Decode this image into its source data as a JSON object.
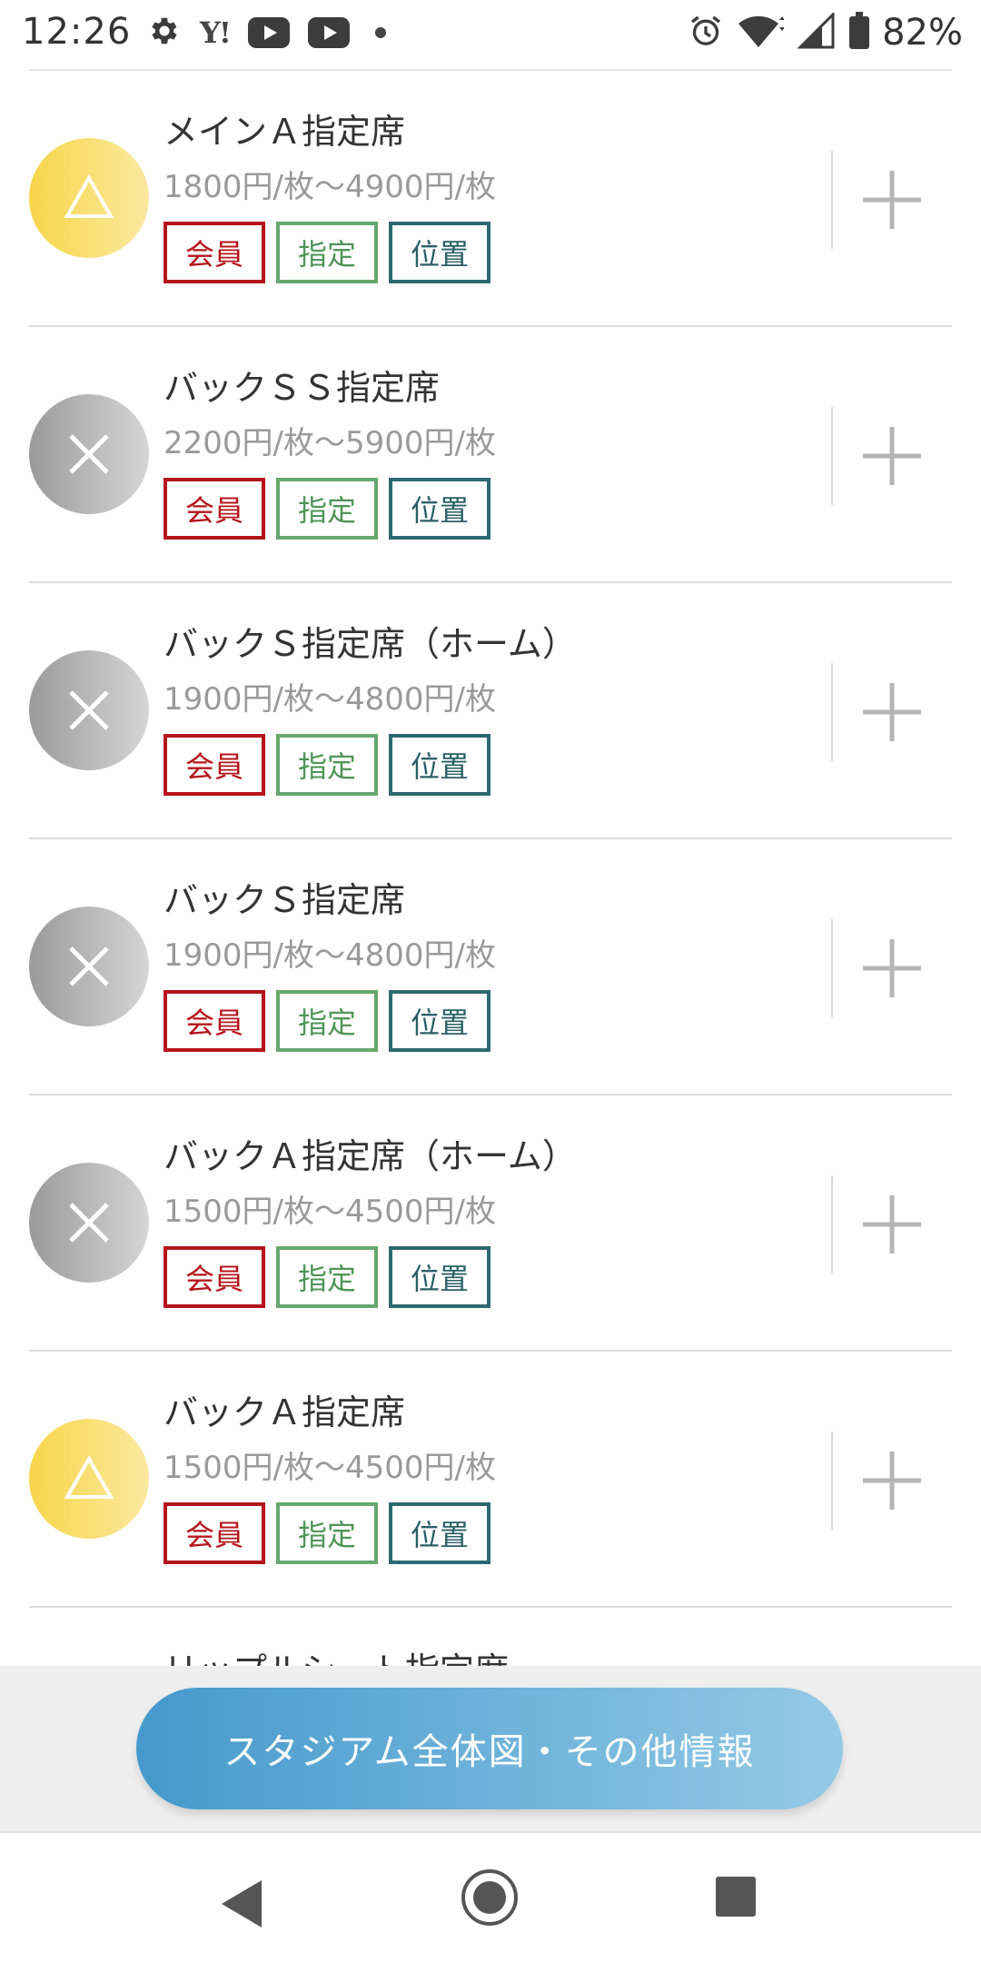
{
  "status_bar": {
    "time": "12:26",
    "battery": "82%",
    "left_icons": [
      "gear-icon",
      "yahoo-icon",
      "youtube-icon",
      "youtube-icon",
      "dot-icon"
    ],
    "right_icons": [
      "alarm-icon",
      "wifi-icon",
      "signal-icon",
      "battery-icon"
    ]
  },
  "seats": [
    {
      "name": "メインＡ指定席",
      "price": "1800円/枚〜4900円/枚",
      "status": "few",
      "status_symbol": "△"
    },
    {
      "name": "バックＳＳ指定席",
      "price": "2200円/枚〜5900円/枚",
      "status": "sold-out",
      "status_symbol": "×"
    },
    {
      "name": "バックＳ指定席（ホーム）",
      "price": "1900円/枚〜4800円/枚",
      "status": "sold-out",
      "status_symbol": "×"
    },
    {
      "name": "バックＳ指定席",
      "price": "1900円/枚〜4800円/枚",
      "status": "sold-out",
      "status_symbol": "×"
    },
    {
      "name": "バックＡ指定席（ホーム）",
      "price": "1500円/枚〜4500円/枚",
      "status": "sold-out",
      "status_symbol": "×"
    },
    {
      "name": "バックＡ指定席",
      "price": "1500円/枚〜4500円/枚",
      "status": "few",
      "status_symbol": "△"
    }
  ],
  "tags": {
    "member": "会員",
    "reserved": "指定",
    "position": "位置"
  },
  "peek_item": "リップルシート指定席",
  "stadium_button": "スタジアム全体図・その他情報",
  "colors": {
    "member_red": "#b4151b",
    "reserved_green": "#66a86e",
    "position_teal": "#2e6870",
    "few_yellow": "#f7d64a",
    "soldout_gray": "#9a9a9a",
    "button_blue": "#4599cc"
  }
}
